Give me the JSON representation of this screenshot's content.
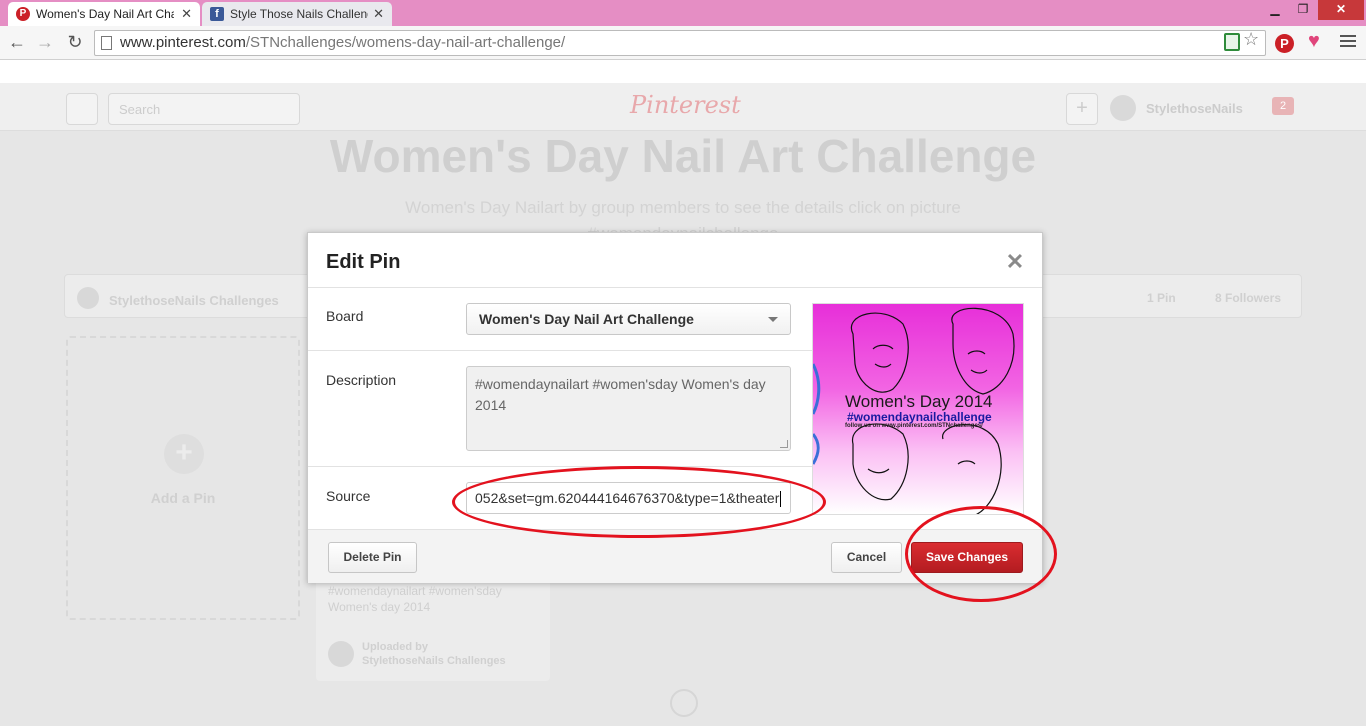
{
  "browser": {
    "tabs": [
      {
        "title": "Women's Day Nail Art Cha",
        "favicon": "pinterest-icon",
        "active": true
      },
      {
        "title": "Style Those Nails Challeng",
        "favicon": "facebook-icon",
        "active": false
      }
    ],
    "url_host": "www.pinterest.com",
    "url_path": "/STNchallenges/womens-day-nail-art-challenge/"
  },
  "page": {
    "search_placeholder": "Search",
    "logo": "Pinterest",
    "username": "StylethoseNails",
    "notifications": "2",
    "board_title": "Women's Day Nail Art Challenge",
    "board_description": "Women's Day Nailart by group members to see the details click on picture #womendaynailchallenge",
    "board_owner": "StylethoseNails Challenges",
    "pin_count": "1 Pin",
    "followers_count": "8 Followers",
    "add_pin_label": "Add a Pin",
    "pin_card_description": "#womendaynailart #women'sday Women's day 2014",
    "uploaded_by_label": "Uploaded by",
    "uploaded_by_name": "StylethoseNails Challenges"
  },
  "modal": {
    "title": "Edit Pin",
    "board_label": "Board",
    "board_value": "Women's Day Nail Art Challenge",
    "description_label": "Description",
    "description_value": "#womendaynailart #women'sday Women's day 2014",
    "source_label": "Source",
    "source_value": "052&set=gm.620444164676370&type=1&theater",
    "preview": {
      "title": "Women's Day 2014",
      "tag": "#womendaynailchallenge",
      "follow": "follow us on www.pinterest.com/STNchallenges/"
    },
    "delete_label": "Delete Pin",
    "cancel_label": "Cancel",
    "save_label": "Save Changes"
  },
  "colors": {
    "brand_red": "#cb2027",
    "annotation_red": "#e3121e",
    "titlebar_pink": "#e58ec4"
  }
}
